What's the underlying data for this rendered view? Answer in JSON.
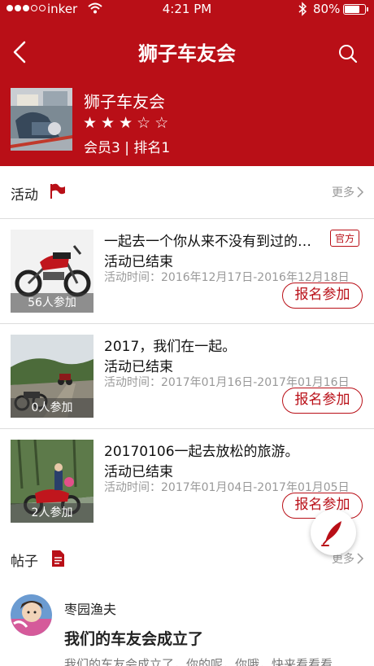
{
  "status_bar": {
    "carrier": "inker",
    "time": "4:21 PM",
    "battery": "80%",
    "battery_level": 0.8,
    "icons": [
      "signal-dots-icon",
      "wifi-icon",
      "bluetooth-icon",
      "battery-icon"
    ]
  },
  "nav": {
    "title": "狮子车友会",
    "back_icon": "chevron-left-icon",
    "search_icon": "search-icon"
  },
  "club": {
    "name": "狮子车友会",
    "rating": 3,
    "rating_max": 5,
    "meta": "会员3 | 排名1"
  },
  "activities_section": {
    "title": "活动",
    "icon": "flag-icon",
    "more": "更多",
    "items": [
      {
        "title": "一起去一个你从来不没有到过的地方",
        "badge": "官方",
        "status": "活动已结束",
        "time": "活动时间：2016年12月17日-2016年12月18日",
        "participants": "56人参加",
        "signup": "报名参加"
      },
      {
        "title": "2017，我们在一起。",
        "badge": "",
        "status": "活动已结束",
        "time": "活动时间：2017年01月16日-2017年01月16日",
        "participants": "0人参加",
        "signup": "报名参加"
      },
      {
        "title": "20170106一起去放松的旅游。",
        "badge": "",
        "status": "活动已结束",
        "time": "活动时间：2017年01月04日-2017年01月05日",
        "participants": "2人参加",
        "signup": "报名参加"
      }
    ]
  },
  "posts_section": {
    "title": "帖子",
    "icon": "document-icon",
    "more": "更多",
    "items": [
      {
        "author": "枣园渔夫",
        "title": "我们的车友会成立了",
        "excerpt": "我们的车友会成立了，你的呢，你哦，快来看看看"
      }
    ]
  },
  "fab": {
    "icon": "feather-pen-icon"
  },
  "colors": {
    "brand_red": "#b90f17",
    "muted_text": "#999999"
  }
}
